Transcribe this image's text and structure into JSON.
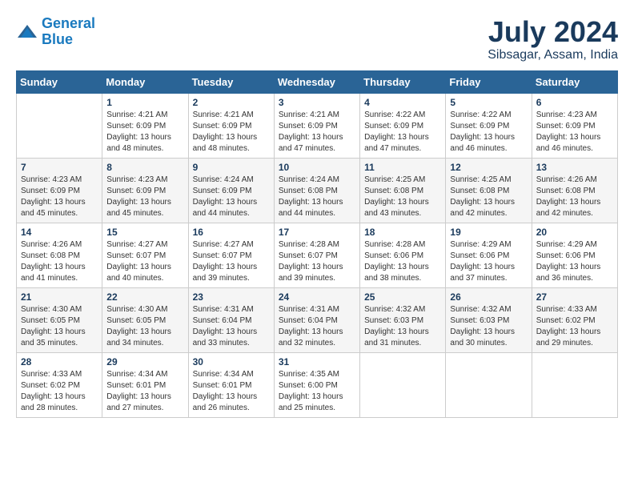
{
  "logo": {
    "line1": "General",
    "line2": "Blue"
  },
  "title": "July 2024",
  "location": "Sibsagar, Assam, India",
  "weekdays": [
    "Sunday",
    "Monday",
    "Tuesday",
    "Wednesday",
    "Thursday",
    "Friday",
    "Saturday"
  ],
  "weeks": [
    [
      {
        "day": "",
        "sunrise": "",
        "sunset": "",
        "daylight": ""
      },
      {
        "day": "1",
        "sunrise": "Sunrise: 4:21 AM",
        "sunset": "Sunset: 6:09 PM",
        "daylight": "Daylight: 13 hours and 48 minutes."
      },
      {
        "day": "2",
        "sunrise": "Sunrise: 4:21 AM",
        "sunset": "Sunset: 6:09 PM",
        "daylight": "Daylight: 13 hours and 48 minutes."
      },
      {
        "day": "3",
        "sunrise": "Sunrise: 4:21 AM",
        "sunset": "Sunset: 6:09 PM",
        "daylight": "Daylight: 13 hours and 47 minutes."
      },
      {
        "day": "4",
        "sunrise": "Sunrise: 4:22 AM",
        "sunset": "Sunset: 6:09 PM",
        "daylight": "Daylight: 13 hours and 47 minutes."
      },
      {
        "day": "5",
        "sunrise": "Sunrise: 4:22 AM",
        "sunset": "Sunset: 6:09 PM",
        "daylight": "Daylight: 13 hours and 46 minutes."
      },
      {
        "day": "6",
        "sunrise": "Sunrise: 4:23 AM",
        "sunset": "Sunset: 6:09 PM",
        "daylight": "Daylight: 13 hours and 46 minutes."
      }
    ],
    [
      {
        "day": "7",
        "sunrise": "Sunrise: 4:23 AM",
        "sunset": "Sunset: 6:09 PM",
        "daylight": "Daylight: 13 hours and 45 minutes."
      },
      {
        "day": "8",
        "sunrise": "Sunrise: 4:23 AM",
        "sunset": "Sunset: 6:09 PM",
        "daylight": "Daylight: 13 hours and 45 minutes."
      },
      {
        "day": "9",
        "sunrise": "Sunrise: 4:24 AM",
        "sunset": "Sunset: 6:09 PM",
        "daylight": "Daylight: 13 hours and 44 minutes."
      },
      {
        "day": "10",
        "sunrise": "Sunrise: 4:24 AM",
        "sunset": "Sunset: 6:08 PM",
        "daylight": "Daylight: 13 hours and 44 minutes."
      },
      {
        "day": "11",
        "sunrise": "Sunrise: 4:25 AM",
        "sunset": "Sunset: 6:08 PM",
        "daylight": "Daylight: 13 hours and 43 minutes."
      },
      {
        "day": "12",
        "sunrise": "Sunrise: 4:25 AM",
        "sunset": "Sunset: 6:08 PM",
        "daylight": "Daylight: 13 hours and 42 minutes."
      },
      {
        "day": "13",
        "sunrise": "Sunrise: 4:26 AM",
        "sunset": "Sunset: 6:08 PM",
        "daylight": "Daylight: 13 hours and 42 minutes."
      }
    ],
    [
      {
        "day": "14",
        "sunrise": "Sunrise: 4:26 AM",
        "sunset": "Sunset: 6:08 PM",
        "daylight": "Daylight: 13 hours and 41 minutes."
      },
      {
        "day": "15",
        "sunrise": "Sunrise: 4:27 AM",
        "sunset": "Sunset: 6:07 PM",
        "daylight": "Daylight: 13 hours and 40 minutes."
      },
      {
        "day": "16",
        "sunrise": "Sunrise: 4:27 AM",
        "sunset": "Sunset: 6:07 PM",
        "daylight": "Daylight: 13 hours and 39 minutes."
      },
      {
        "day": "17",
        "sunrise": "Sunrise: 4:28 AM",
        "sunset": "Sunset: 6:07 PM",
        "daylight": "Daylight: 13 hours and 39 minutes."
      },
      {
        "day": "18",
        "sunrise": "Sunrise: 4:28 AM",
        "sunset": "Sunset: 6:06 PM",
        "daylight": "Daylight: 13 hours and 38 minutes."
      },
      {
        "day": "19",
        "sunrise": "Sunrise: 4:29 AM",
        "sunset": "Sunset: 6:06 PM",
        "daylight": "Daylight: 13 hours and 37 minutes."
      },
      {
        "day": "20",
        "sunrise": "Sunrise: 4:29 AM",
        "sunset": "Sunset: 6:06 PM",
        "daylight": "Daylight: 13 hours and 36 minutes."
      }
    ],
    [
      {
        "day": "21",
        "sunrise": "Sunrise: 4:30 AM",
        "sunset": "Sunset: 6:05 PM",
        "daylight": "Daylight: 13 hours and 35 minutes."
      },
      {
        "day": "22",
        "sunrise": "Sunrise: 4:30 AM",
        "sunset": "Sunset: 6:05 PM",
        "daylight": "Daylight: 13 hours and 34 minutes."
      },
      {
        "day": "23",
        "sunrise": "Sunrise: 4:31 AM",
        "sunset": "Sunset: 6:04 PM",
        "daylight": "Daylight: 13 hours and 33 minutes."
      },
      {
        "day": "24",
        "sunrise": "Sunrise: 4:31 AM",
        "sunset": "Sunset: 6:04 PM",
        "daylight": "Daylight: 13 hours and 32 minutes."
      },
      {
        "day": "25",
        "sunrise": "Sunrise: 4:32 AM",
        "sunset": "Sunset: 6:03 PM",
        "daylight": "Daylight: 13 hours and 31 minutes."
      },
      {
        "day": "26",
        "sunrise": "Sunrise: 4:32 AM",
        "sunset": "Sunset: 6:03 PM",
        "daylight": "Daylight: 13 hours and 30 minutes."
      },
      {
        "day": "27",
        "sunrise": "Sunrise: 4:33 AM",
        "sunset": "Sunset: 6:02 PM",
        "daylight": "Daylight: 13 hours and 29 minutes."
      }
    ],
    [
      {
        "day": "28",
        "sunrise": "Sunrise: 4:33 AM",
        "sunset": "Sunset: 6:02 PM",
        "daylight": "Daylight: 13 hours and 28 minutes."
      },
      {
        "day": "29",
        "sunrise": "Sunrise: 4:34 AM",
        "sunset": "Sunset: 6:01 PM",
        "daylight": "Daylight: 13 hours and 27 minutes."
      },
      {
        "day": "30",
        "sunrise": "Sunrise: 4:34 AM",
        "sunset": "Sunset: 6:01 PM",
        "daylight": "Daylight: 13 hours and 26 minutes."
      },
      {
        "day": "31",
        "sunrise": "Sunrise: 4:35 AM",
        "sunset": "Sunset: 6:00 PM",
        "daylight": "Daylight: 13 hours and 25 minutes."
      },
      {
        "day": "",
        "sunrise": "",
        "sunset": "",
        "daylight": ""
      },
      {
        "day": "",
        "sunrise": "",
        "sunset": "",
        "daylight": ""
      },
      {
        "day": "",
        "sunrise": "",
        "sunset": "",
        "daylight": ""
      }
    ]
  ]
}
